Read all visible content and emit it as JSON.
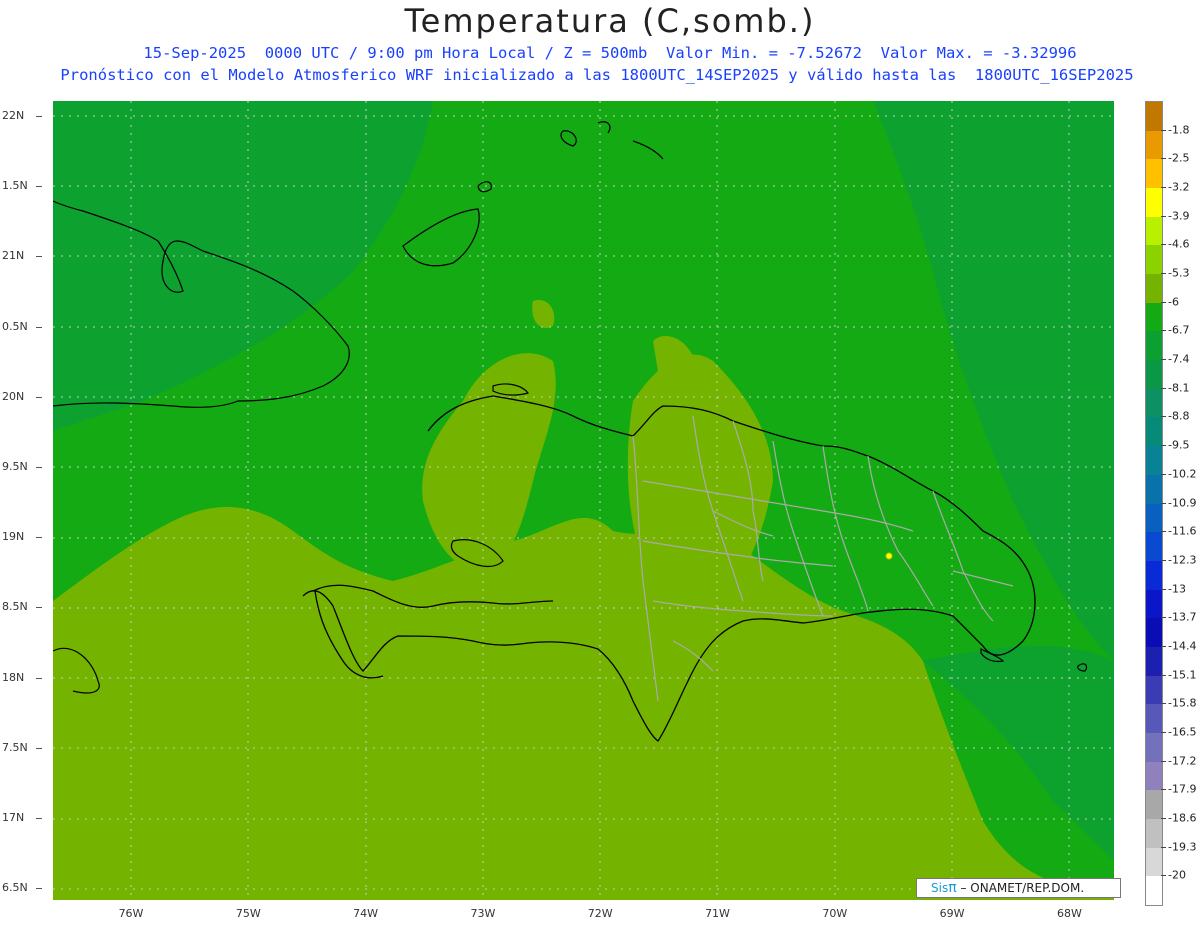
{
  "title": "Temperatura (C,somb.)",
  "subtitle1": "15-Sep-2025  0000 UTC / 9:00 pm Hora Local / Z = 500mb  Valor Min. = -7.52672  Valor Max. = -3.32996",
  "subtitle2": "Pronóstico con el Modelo Atmosferico WRF inicializado a las 1800UTC_14SEP2025 y válido hasta las  1800UTC_16SEP2025",
  "lat_labels": [
    "22N",
    "1.5N",
    "21N",
    "0.5N",
    "20N",
    "9.5N",
    "19N",
    "8.5N",
    "18N",
    "7.5N",
    "17N",
    "6.5N"
  ],
  "lon_labels": [
    "76W",
    "75W",
    "74W",
    "73W",
    "72W",
    "71W",
    "70W",
    "69W",
    "68W"
  ],
  "colorbar": {
    "labels": [
      "-1.8",
      "-2.5",
      "-3.2",
      "-3.9",
      "-4.6",
      "-5.3",
      "-6",
      "-6.7",
      "-7.4",
      "-8.1",
      "-8.8",
      "-9.5",
      "-10.2",
      "-10.9",
      "-11.6",
      "-12.3",
      "-13",
      "-13.7",
      "-14.4",
      "-15.1",
      "-15.8",
      "-16.5",
      "-17.2",
      "-17.9",
      "-18.6",
      "-19.3",
      "-20"
    ],
    "colors": [
      "#c07800",
      "#e89a00",
      "#ffc000",
      "#ffff00",
      "#b8f000",
      "#8cd200",
      "#74b400",
      "#14aa14",
      "#0ca032",
      "#0a9846",
      "#0c9064",
      "#088a78",
      "#0a8296",
      "#0a72aa",
      "#0a60c0",
      "#0a4ad0",
      "#0a2ad8",
      "#0a16c8",
      "#0a0cb4",
      "#1c20b0",
      "#3a3cb4",
      "#5858b8",
      "#7470bc",
      "#9080bc",
      "#a8a8a8",
      "#c0c0c0",
      "#d8d8d8",
      "#ffffff"
    ]
  },
  "field_colors": {
    "sea_base": "#14aa14",
    "dark_green": "#0ca032",
    "light_green": "#74b400",
    "coast": "#000000",
    "provinces": "#aaaaaa",
    "grid": "#cccccc",
    "max_marker": "#ffff00"
  },
  "credit": {
    "sis": "Sis",
    "pi": "π",
    "rest": " – ONAMET/REP.DOM."
  }
}
